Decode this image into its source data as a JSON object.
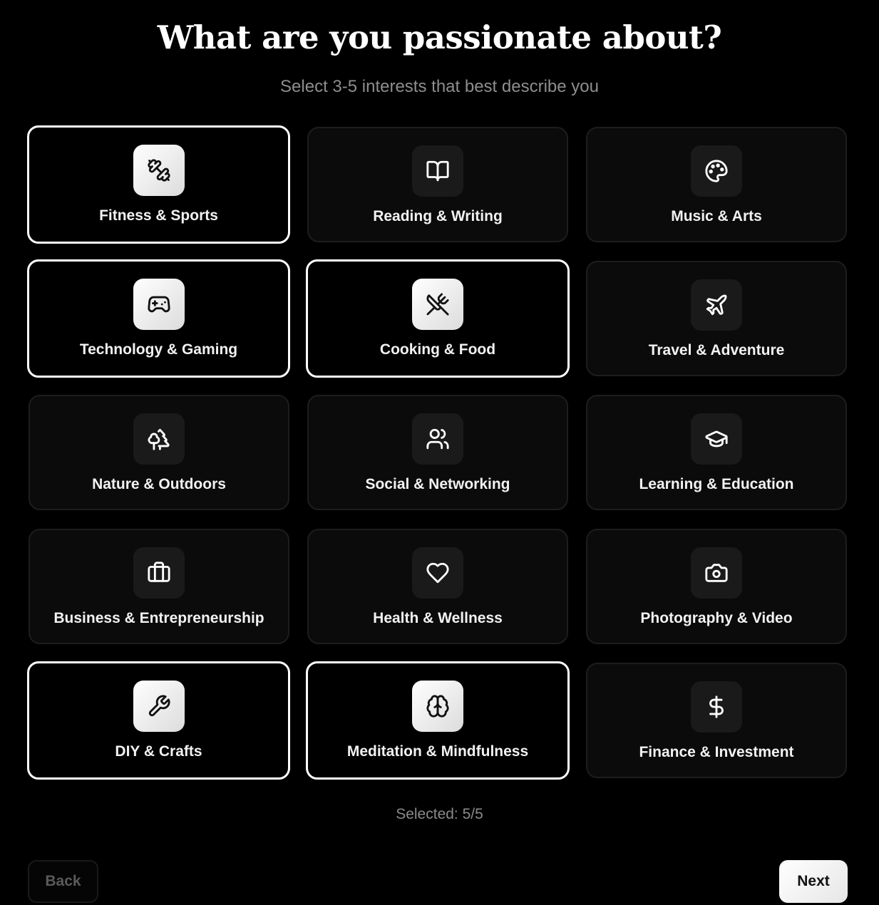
{
  "header": {
    "title": "What are you passionate about?",
    "subtitle": "Select 3-5 interests that best describe you"
  },
  "interests": [
    {
      "label": "Fitness & Sports",
      "icon": "dumbbell-icon",
      "selected": true
    },
    {
      "label": "Reading & Writing",
      "icon": "book-icon",
      "selected": false
    },
    {
      "label": "Music & Arts",
      "icon": "palette-icon",
      "selected": false
    },
    {
      "label": "Technology & Gaming",
      "icon": "gamepad-icon",
      "selected": true
    },
    {
      "label": "Cooking & Food",
      "icon": "utensils-icon",
      "selected": true
    },
    {
      "label": "Travel & Adventure",
      "icon": "plane-icon",
      "selected": false
    },
    {
      "label": "Nature & Outdoors",
      "icon": "trees-icon",
      "selected": false
    },
    {
      "label": "Social & Networking",
      "icon": "users-icon",
      "selected": false
    },
    {
      "label": "Learning & Education",
      "icon": "graduation-cap-icon",
      "selected": false
    },
    {
      "label": "Business & Entrepreneurship",
      "icon": "briefcase-icon",
      "selected": false
    },
    {
      "label": "Health & Wellness",
      "icon": "heart-icon",
      "selected": false
    },
    {
      "label": "Photography & Video",
      "icon": "camera-icon",
      "selected": false
    },
    {
      "label": "DIY & Crafts",
      "icon": "wrench-icon",
      "selected": true
    },
    {
      "label": "Meditation & Mindfulness",
      "icon": "brain-icon",
      "selected": true
    },
    {
      "label": "Finance & Investment",
      "icon": "dollar-icon",
      "selected": false
    }
  ],
  "footer": {
    "selected_text": "Selected: 5/5",
    "back_label": "Back",
    "next_label": "Next"
  },
  "colors": {
    "background": "#000000",
    "card": "#0b0b0b",
    "selected_border": "#ffffff",
    "muted_text": "#8e8e8e"
  }
}
